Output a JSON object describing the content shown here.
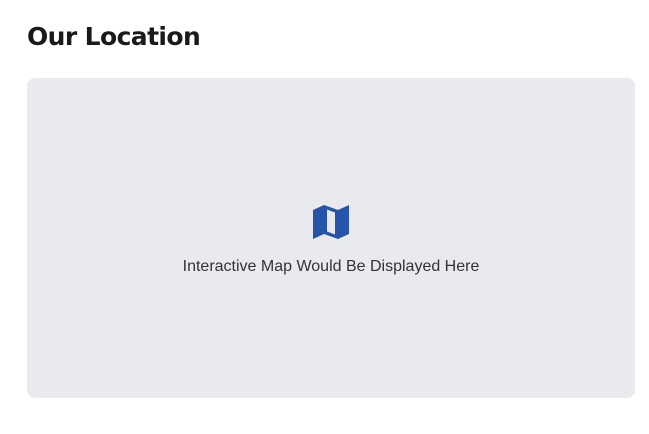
{
  "location_section": {
    "title": "Our Location",
    "map": {
      "icon": "map-icon",
      "caption": "Interactive Map Would Be Displayed Here",
      "icon_color": "#2554a8",
      "background_color": "#e9eaee"
    }
  }
}
